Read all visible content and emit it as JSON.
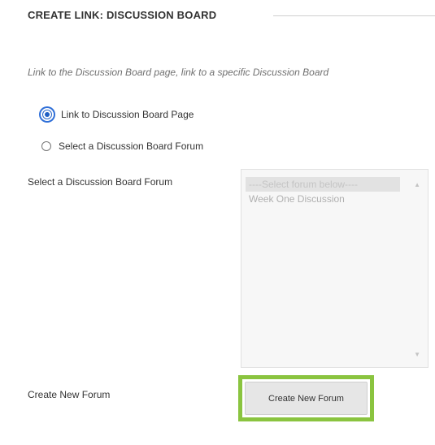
{
  "section": {
    "heading": "CREATE LINK: DISCUSSION BOARD"
  },
  "instructions": "Link to the Discussion Board page, link to a specific Discussion Board",
  "link_type": {
    "options": [
      {
        "label": "Link to Discussion Board Page",
        "selected": true
      },
      {
        "label": "Select a Discussion Board Forum",
        "selected": false
      }
    ]
  },
  "forum_select": {
    "label": "Select a Discussion Board Forum",
    "options": [
      {
        "label": "----Select forum below----",
        "selected": true
      },
      {
        "label": "Week One Discussion",
        "selected": false
      }
    ],
    "disabled": true
  },
  "create_forum": {
    "label": "Create New Forum",
    "button_label": "Create New Forum"
  },
  "colors": {
    "highlight": "#8ac43f",
    "radio_selected": "#1f5fc4"
  },
  "icons": {
    "scroll_up": "up-arrow-icon",
    "scroll_down": "down-arrow-icon"
  }
}
